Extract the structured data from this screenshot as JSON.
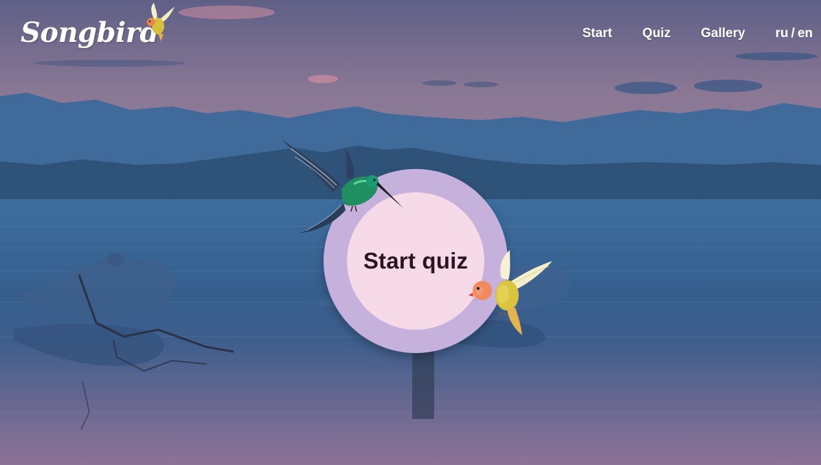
{
  "logo": {
    "text": "Songbird",
    "icon": "lovebird-icon"
  },
  "nav": {
    "items": [
      {
        "label": "Start"
      },
      {
        "label": "Quiz"
      },
      {
        "label": "Gallery"
      }
    ],
    "lang": {
      "ru": "ru",
      "sep": "/",
      "en": "en"
    }
  },
  "hero": {
    "start_label": "Start quiz",
    "decorations": [
      "hummingbird-icon",
      "lovebird-icon"
    ]
  },
  "colors": {
    "sky_top": "#6f6a8f",
    "water": "#3a5f8c",
    "button_ring": "#c6b0dc",
    "button_fill": "#f6dae7",
    "button_text": "#2c1324",
    "nav_text": "#ffffff"
  }
}
